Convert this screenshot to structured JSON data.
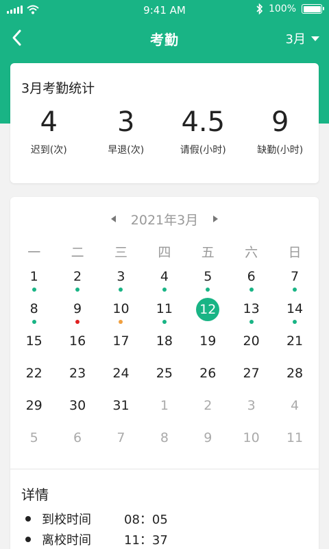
{
  "status_bar": {
    "time": "9:41 AM",
    "battery_text": "100%",
    "battery_level": 1.0,
    "icons": [
      "signal-icon",
      "wifi-icon",
      "bluetooth-icon",
      "battery-icon"
    ]
  },
  "nav": {
    "title": "考勤",
    "month": "3月",
    "back_icon": "back-arrow-icon",
    "dropdown_icon": "caret-down-icon"
  },
  "stats": {
    "title": "3月考勤统计",
    "items": [
      {
        "value": "4",
        "label": "迟到(次)"
      },
      {
        "value": "3",
        "label": "早退(次)"
      },
      {
        "value": "4.5",
        "label": "请假(小时)"
      },
      {
        "value": "9",
        "label": "缺勤(小时)"
      }
    ]
  },
  "calendar": {
    "title": "2021年3月",
    "weekdays": [
      "一",
      "二",
      "三",
      "四",
      "五",
      "六",
      "日"
    ],
    "weeks": [
      [
        {
          "d": "1",
          "dot": "green"
        },
        {
          "d": "2",
          "dot": "green"
        },
        {
          "d": "3",
          "dot": "green"
        },
        {
          "d": "4",
          "dot": "green"
        },
        {
          "d": "5",
          "dot": "green"
        },
        {
          "d": "6",
          "dot": "green"
        },
        {
          "d": "7",
          "dot": "green"
        }
      ],
      [
        {
          "d": "8",
          "dot": "green"
        },
        {
          "d": "9",
          "dot": "red"
        },
        {
          "d": "10",
          "dot": "orange"
        },
        {
          "d": "11",
          "dot": "green"
        },
        {
          "d": "12",
          "today": true
        },
        {
          "d": "13",
          "dot": "green"
        },
        {
          "d": "14",
          "dot": "green"
        }
      ],
      [
        {
          "d": "15"
        },
        {
          "d": "16"
        },
        {
          "d": "17"
        },
        {
          "d": "18"
        },
        {
          "d": "19"
        },
        {
          "d": "20"
        },
        {
          "d": "21"
        }
      ],
      [
        {
          "d": "22"
        },
        {
          "d": "23"
        },
        {
          "d": "24"
        },
        {
          "d": "25"
        },
        {
          "d": "26"
        },
        {
          "d": "27"
        },
        {
          "d": "28"
        }
      ],
      [
        {
          "d": "29"
        },
        {
          "d": "30"
        },
        {
          "d": "31"
        },
        {
          "d": "1",
          "muted": true
        },
        {
          "d": "2",
          "muted": true
        },
        {
          "d": "3",
          "muted": true
        },
        {
          "d": "4",
          "muted": true
        }
      ],
      [
        {
          "d": "5",
          "muted": true
        },
        {
          "d": "6",
          "muted": true
        },
        {
          "d": "7",
          "muted": true
        },
        {
          "d": "8",
          "muted": true
        },
        {
          "d": "9",
          "muted": true
        },
        {
          "d": "10",
          "muted": true
        },
        {
          "d": "11",
          "muted": true
        }
      ]
    ]
  },
  "details": {
    "title": "详情",
    "items": [
      {
        "label": "到校时间",
        "value": "08：05"
      },
      {
        "label": "离校时间",
        "value": "11：37"
      }
    ]
  },
  "colors": {
    "brand": "#19b485",
    "dot_green": "#19b485",
    "dot_red": "#e02020",
    "dot_orange": "#f0a040"
  }
}
